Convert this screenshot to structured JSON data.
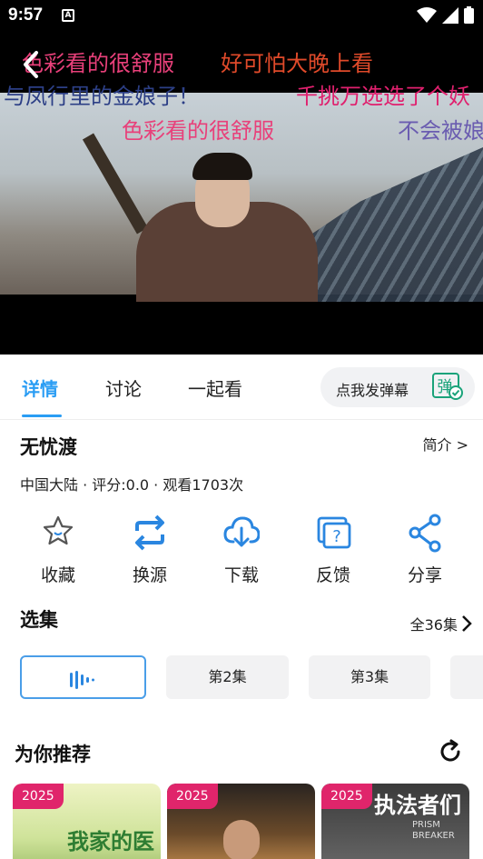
{
  "status_bar": {
    "time": "9:57",
    "keyboard_badge": "A"
  },
  "danmaku": [
    {
      "text": "色彩看的很舒服",
      "color": "#e8407a"
    },
    {
      "text": "好可怕大晚上看",
      "color": "#e04a2a"
    },
    {
      "text": "与凤行里的金娘子！",
      "color": "#2c3f86"
    },
    {
      "text": "千挑万选选了个妖",
      "color": "#e0206e"
    },
    {
      "text": "色彩看的很舒服",
      "color": "#e8407a"
    },
    {
      "text": "不会被娘",
      "color": "#6a5cb0"
    }
  ],
  "tabs": [
    {
      "label": "详情",
      "active": true
    },
    {
      "label": "讨论",
      "active": false
    },
    {
      "label": "一起看",
      "active": false
    }
  ],
  "danmaku_send": {
    "label": "点我发弹幕",
    "toggle_glyph": "弹"
  },
  "show": {
    "title": "无忧渡",
    "intro_link": "简介 >",
    "meta": "中国大陆 · 评分:0.0 · 观看1703次"
  },
  "actions": [
    {
      "label": "收藏",
      "icon": "star-icon"
    },
    {
      "label": "换源",
      "icon": "switch-source-icon"
    },
    {
      "label": "下载",
      "icon": "download-icon"
    },
    {
      "label": "反馈",
      "icon": "feedback-icon"
    },
    {
      "label": "分享",
      "icon": "share-icon"
    }
  ],
  "episodes": {
    "title": "选集",
    "all_label": "全36集",
    "items": [
      {
        "label": "",
        "current": true,
        "icon": "playing-wave-icon"
      },
      {
        "label": "第2集",
        "current": false
      },
      {
        "label": "第3集",
        "current": false
      }
    ]
  },
  "recommend": {
    "title": "为你推荐",
    "posters": [
      {
        "badge": "2025",
        "text": "我家的医生"
      },
      {
        "badge": "2025",
        "text": ""
      },
      {
        "badge": "2025",
        "text": "执法者们",
        "subtitle": "PRISM BREAKER"
      }
    ]
  },
  "colors": {
    "accent": "#2a9df4",
    "badge": "#e0256b",
    "icon_blue": "#2a86e0"
  }
}
